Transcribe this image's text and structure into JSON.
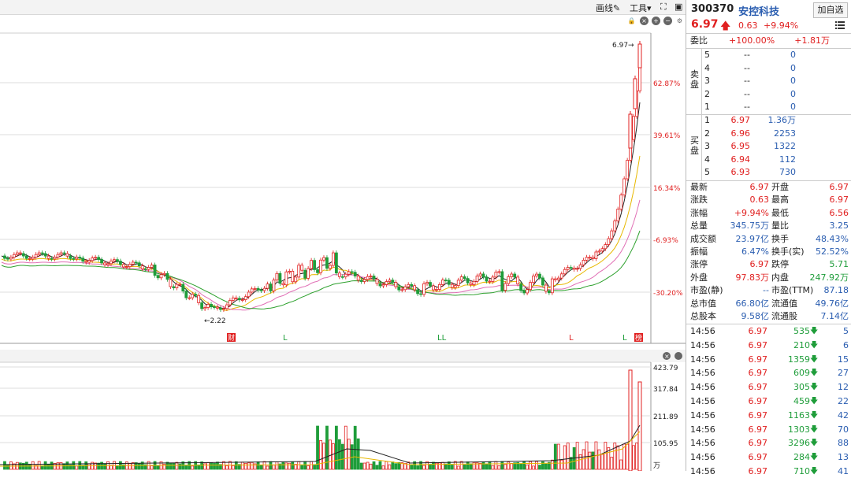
{
  "toolbar": {
    "draw_label": "画线",
    "tools_label": "工具"
  },
  "stock": {
    "code": "300370",
    "name": "安控科技",
    "add_label": "加自选",
    "price": "6.97",
    "change": "0.63",
    "change_pct": "+9.94%"
  },
  "price_axis": [
    {
      "label": "62.87%"
    },
    {
      "label": "39.61%"
    },
    {
      "label": "16.34%"
    },
    {
      "label": "-6.93%"
    },
    {
      "label": "-30.20%"
    }
  ],
  "chart_annotations": {
    "high_label": "6.97→",
    "low_label": "←2.22",
    "markers": [
      "财",
      "L",
      "LL",
      "L",
      "L",
      "榜"
    ]
  },
  "volume_axis": [
    {
      "label": "423.79"
    },
    {
      "label": "317.84"
    },
    {
      "label": "211.89"
    },
    {
      "label": "105.95"
    },
    {
      "label": "万"
    }
  ],
  "weibi": {
    "label": "委比",
    "pct": "+100.00%",
    "diff": "+1.81万"
  },
  "sell": {
    "label_a": "卖",
    "label_b": "盘",
    "rows": [
      {
        "level": "5",
        "price": "--",
        "vol": "0"
      },
      {
        "level": "4",
        "price": "--",
        "vol": "0"
      },
      {
        "level": "3",
        "price": "--",
        "vol": "0"
      },
      {
        "level": "2",
        "price": "--",
        "vol": "0"
      },
      {
        "level": "1",
        "price": "--",
        "vol": "0"
      }
    ]
  },
  "buy": {
    "label_a": "买",
    "label_b": "盘",
    "rows": [
      {
        "level": "1",
        "price": "6.97",
        "vol": "1.36万"
      },
      {
        "level": "2",
        "price": "6.96",
        "vol": "2253"
      },
      {
        "level": "3",
        "price": "6.95",
        "vol": "1322"
      },
      {
        "level": "4",
        "price": "6.94",
        "vol": "112"
      },
      {
        "level": "5",
        "price": "6.93",
        "vol": "730"
      }
    ]
  },
  "quote": [
    {
      "k1": "最新",
      "v1": "6.97",
      "c1": "red",
      "k2": "开盘",
      "v2": "6.97",
      "c2": "red"
    },
    {
      "k1": "涨跌",
      "v1": "0.63",
      "c1": "red",
      "k2": "最高",
      "v2": "6.97",
      "c2": "red"
    },
    {
      "k1": "涨幅",
      "v1": "+9.94%",
      "c1": "red",
      "k2": "最低",
      "v2": "6.56",
      "c2": "red"
    },
    {
      "k1": "总量",
      "v1": "345.75万",
      "c1": "blue",
      "k2": "量比",
      "v2": "3.25",
      "c2": "blue"
    },
    {
      "k1": "成交额",
      "v1": "23.97亿",
      "c1": "blue",
      "k2": "换手",
      "v2": "48.43%",
      "c2": "blue"
    },
    {
      "k1": "振幅",
      "v1": "6.47%",
      "c1": "blue",
      "k2": "换手(实)",
      "v2": "52.52%",
      "c2": "blue"
    },
    {
      "k1": "涨停",
      "v1": "6.97",
      "c1": "red",
      "k2": "跌停",
      "v2": "5.71",
      "c2": "green"
    },
    {
      "k1": "外盘",
      "v1": "97.83万",
      "c1": "red",
      "k2": "内盘",
      "v2": "247.92万",
      "c2": "green"
    },
    {
      "k1": "市盈(静)",
      "v1": "--",
      "c1": "blue",
      "k2": "市盈(TTM)",
      "v2": "87.18",
      "c2": "blue"
    },
    {
      "k1": "总市值",
      "v1": "66.80亿",
      "c1": "blue",
      "k2": "流通值",
      "v2": "49.76亿",
      "c2": "blue"
    },
    {
      "k1": "总股本",
      "v1": "9.58亿",
      "c1": "blue",
      "k2": "流通股",
      "v2": "7.14亿",
      "c2": "blue"
    }
  ],
  "trades": [
    {
      "time": "14:56",
      "price": "6.97",
      "vol": "535",
      "count": "5"
    },
    {
      "time": "14:56",
      "price": "6.97",
      "vol": "210",
      "count": "6"
    },
    {
      "time": "14:56",
      "price": "6.97",
      "vol": "1359",
      "count": "15"
    },
    {
      "time": "14:56",
      "price": "6.97",
      "vol": "609",
      "count": "27"
    },
    {
      "time": "14:56",
      "price": "6.97",
      "vol": "305",
      "count": "12"
    },
    {
      "time": "14:56",
      "price": "6.97",
      "vol": "459",
      "count": "22"
    },
    {
      "time": "14:56",
      "price": "6.97",
      "vol": "1163",
      "count": "42"
    },
    {
      "time": "14:56",
      "price": "6.97",
      "vol": "1303",
      "count": "70"
    },
    {
      "time": "14:56",
      "price": "6.97",
      "vol": "3296",
      "count": "88"
    },
    {
      "time": "14:56",
      "price": "6.97",
      "vol": "284",
      "count": "13"
    },
    {
      "time": "14:56",
      "price": "6.97",
      "vol": "710",
      "count": "41"
    }
  ],
  "colors": {
    "up": "#e02020",
    "down": "#1f9d3a",
    "blue": "#2a5db0"
  }
}
